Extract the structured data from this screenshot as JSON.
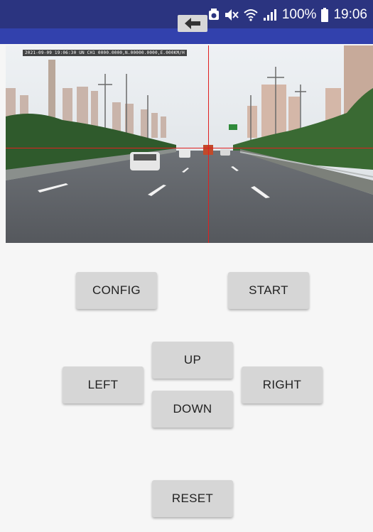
{
  "status_bar": {
    "battery_percent": "100%",
    "time": "19:06",
    "icons": [
      "alarm-icon",
      "mute-icon",
      "wifi-icon",
      "signal-icon",
      "battery-icon"
    ]
  },
  "nav": {
    "back_icon": "back-arrow-icon"
  },
  "video": {
    "osd_text": "2021-09-09 19:06:30 UN  CH1 0000.0000,N.00000.0000,E.000KM/H"
  },
  "controls": {
    "config_label": "CONFIG",
    "start_label": "START",
    "up_label": "UP",
    "left_label": "LEFT",
    "right_label": "RIGHT",
    "down_label": "DOWN",
    "reset_label": "RESET"
  },
  "colors": {
    "status_bar": "#2b3480",
    "app_bar": "#3241ad",
    "crosshair": "#e02020",
    "button_bg": "#d6d6d6",
    "background": "#f6f6f6"
  }
}
